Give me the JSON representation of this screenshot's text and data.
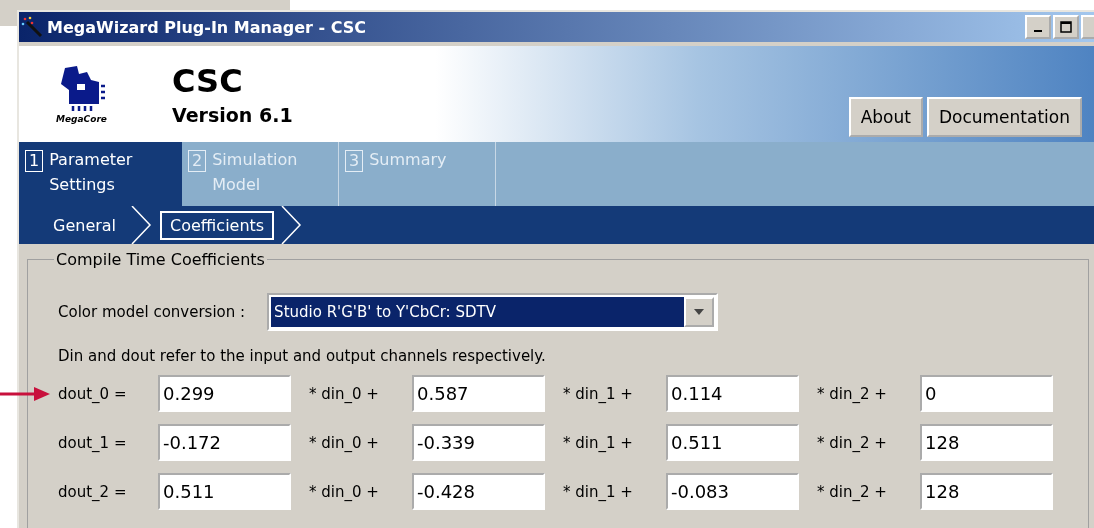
{
  "window": {
    "title": "MegaWizard Plug-In Manager - CSC"
  },
  "header": {
    "logo_caption": "MegaCore",
    "title": "CSC",
    "version": "Version 6.1",
    "buttons": [
      "About",
      "Documentation"
    ]
  },
  "tabs": [
    {
      "number": "1",
      "label": "Parameter Settings",
      "selected": true
    },
    {
      "number": "2",
      "label": "Simulation Model",
      "selected": false
    },
    {
      "number": "3",
      "label": "Summary",
      "selected": false
    }
  ],
  "breadcrumb": [
    {
      "label": "General",
      "selected": false
    },
    {
      "label": "Coefficients",
      "selected": true
    }
  ],
  "group": {
    "title": "Compile Time Coefficients",
    "conversion_label": "Color model conversion :",
    "conversion_value": "Studio R'G'B' to Y'CbCr: SDTV",
    "note": "Din and dout refer to the input and output channels respectively.",
    "rows": [
      {
        "label": "dout_0 =",
        "coefficients": [
          {
            "value": "0.299",
            "operator": "* din_0 +"
          },
          {
            "value": "0.587",
            "operator": "* din_1 +"
          },
          {
            "value": "0.114",
            "operator": "* din_2 +"
          },
          {
            "value": "0"
          }
        ]
      },
      {
        "label": "dout_1 =",
        "coefficients": [
          {
            "value": "-0.172",
            "operator": "* din_0 +"
          },
          {
            "value": "-0.339",
            "operator": "* din_1 +"
          },
          {
            "value": "0.511",
            "operator": "* din_2 +"
          },
          {
            "value": "128"
          }
        ]
      },
      {
        "label": "dout_2 =",
        "coefficients": [
          {
            "value": "0.511",
            "operator": "* din_0 +"
          },
          {
            "value": "-0.428",
            "operator": "* din_1 +"
          },
          {
            "value": "-0.083",
            "operator": "* din_2 +"
          },
          {
            "value": "128"
          }
        ]
      }
    ]
  }
}
